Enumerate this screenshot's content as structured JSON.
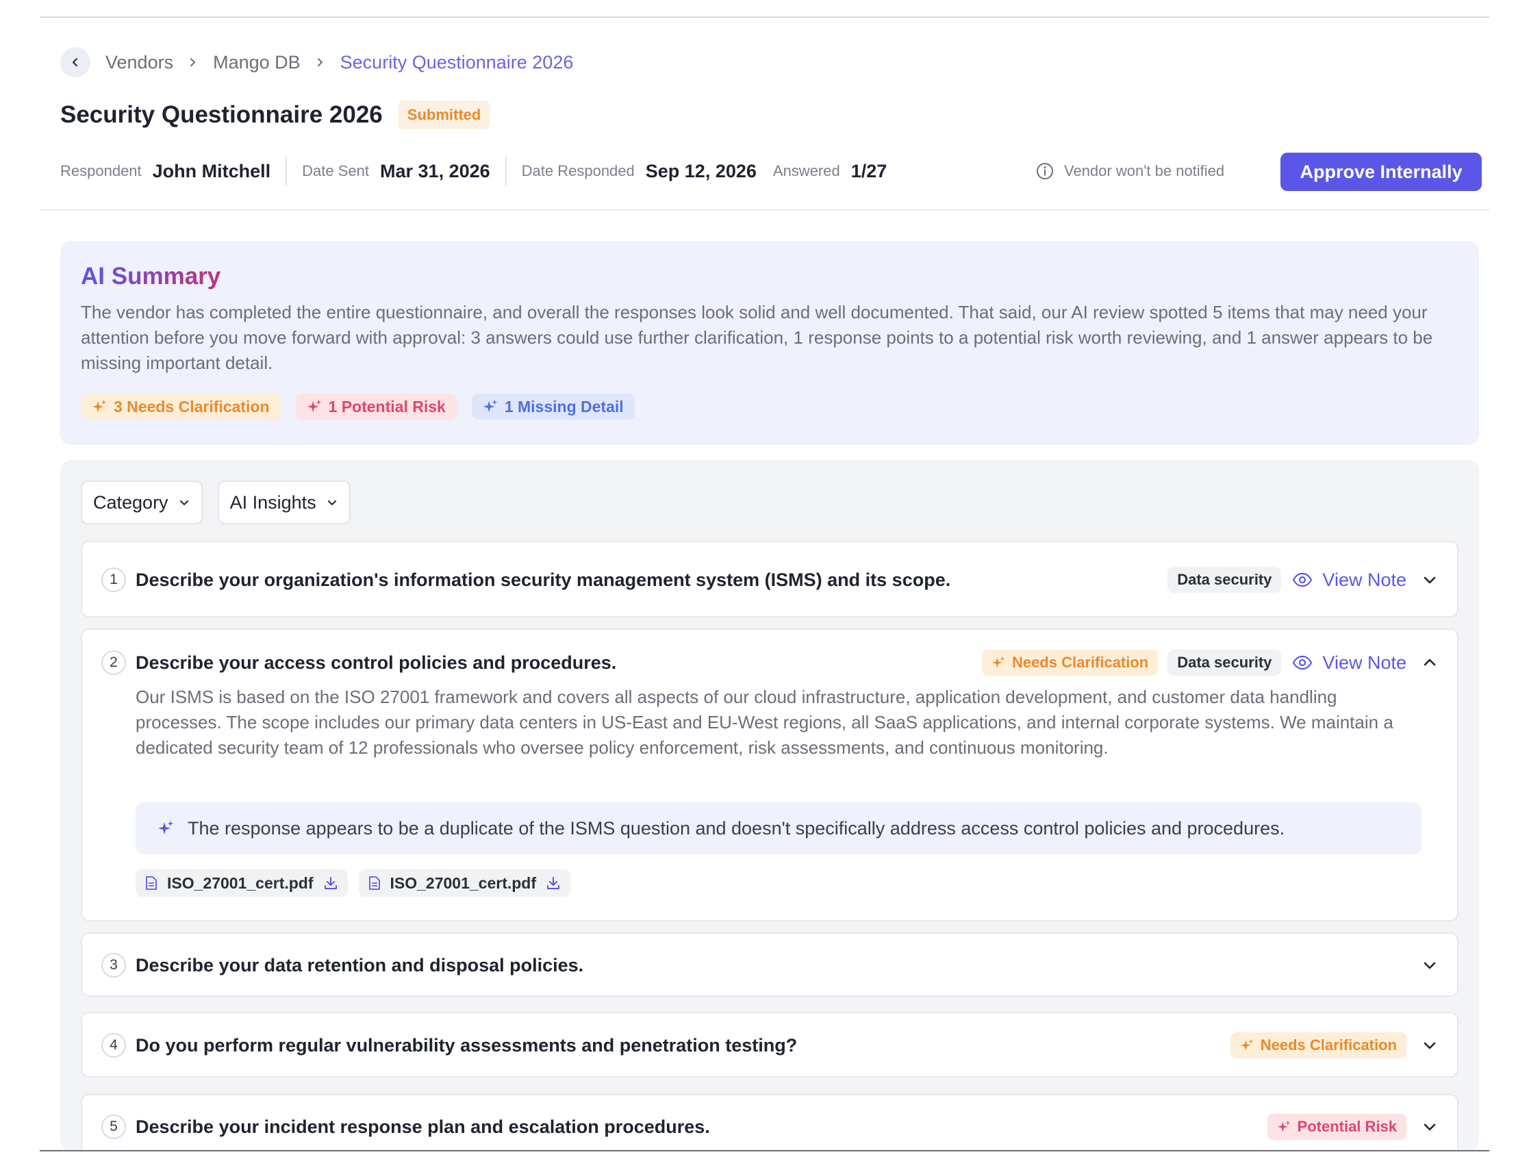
{
  "breadcrumb": {
    "items": [
      "Vendors",
      "Mango DB"
    ],
    "current": "Security Questionnaire 2026"
  },
  "header": {
    "title": "Security Questionnaire 2026",
    "status": "Submitted",
    "meta": {
      "respondent_label": "Respondent",
      "respondent": "John Mitchell",
      "date_sent_label": "Date Sent",
      "date_sent": "Mar 31, 2026",
      "date_responded_label": "Date Responded",
      "date_responded": "Sep 12, 2026",
      "answered_label": "Answered",
      "answered": "1/27"
    },
    "notify_text": "Vendor won't be notified",
    "approve_label": "Approve Internally"
  },
  "ai_summary": {
    "title": "AI Summary",
    "text": "The vendor has completed the entire questionnaire, and overall the responses look solid and well documented. That said, our AI review spotted 5 items that may need your attention before you move forward with approval: 3 answers could use further clarification, 1 response points to a potential risk worth reviewing, and 1 answer appears to be missing important detail.",
    "chips": {
      "clarification": "3 Needs Clarification",
      "risk": "1 Potential Risk",
      "missing": "1 Missing Detail"
    }
  },
  "filters": {
    "category": "Category",
    "ai_insights": "AI Insights"
  },
  "questions": [
    {
      "num": "1",
      "text": "Describe your organization's information security management system (ISMS) and its scope.",
      "category": "Data security",
      "view_note": "View Note"
    },
    {
      "num": "2",
      "text": "Describe your access control policies and procedures.",
      "insight_tag": "Needs Clarification",
      "category": "Data security",
      "view_note": "View Note",
      "answer": "Our ISMS is based on the ISO 27001 framework and covers all aspects of our cloud infrastructure, application development, and customer data handling processes. The scope includes our primary data centers in US-East and EU-West regions, all SaaS applications, and internal corporate systems. We maintain a dedicated security team of 12 professionals who oversee policy enforcement, risk assessments, and continuous monitoring.",
      "ai_insight": "The response appears to be a duplicate of the ISMS question and doesn't specifically address access control policies and procedures.",
      "attachments": [
        "ISO_27001_cert.pdf",
        "ISO_27001_cert.pdf"
      ]
    },
    {
      "num": "3",
      "text": "Describe your data retention and disposal policies."
    },
    {
      "num": "4",
      "text": "Do you perform regular vulnerability assessments and penetration testing?",
      "insight_tag": "Needs Clarification"
    },
    {
      "num": "5",
      "text": "Describe your incident response plan and escalation procedures.",
      "insight_tag": "Potential Risk"
    }
  ],
  "colors": {
    "primary": "#5b56e8",
    "clarification": "#ea8a2c",
    "risk": "#e0476a",
    "missing": "#4f6fe0",
    "summary_bg": "#eff1fc"
  }
}
